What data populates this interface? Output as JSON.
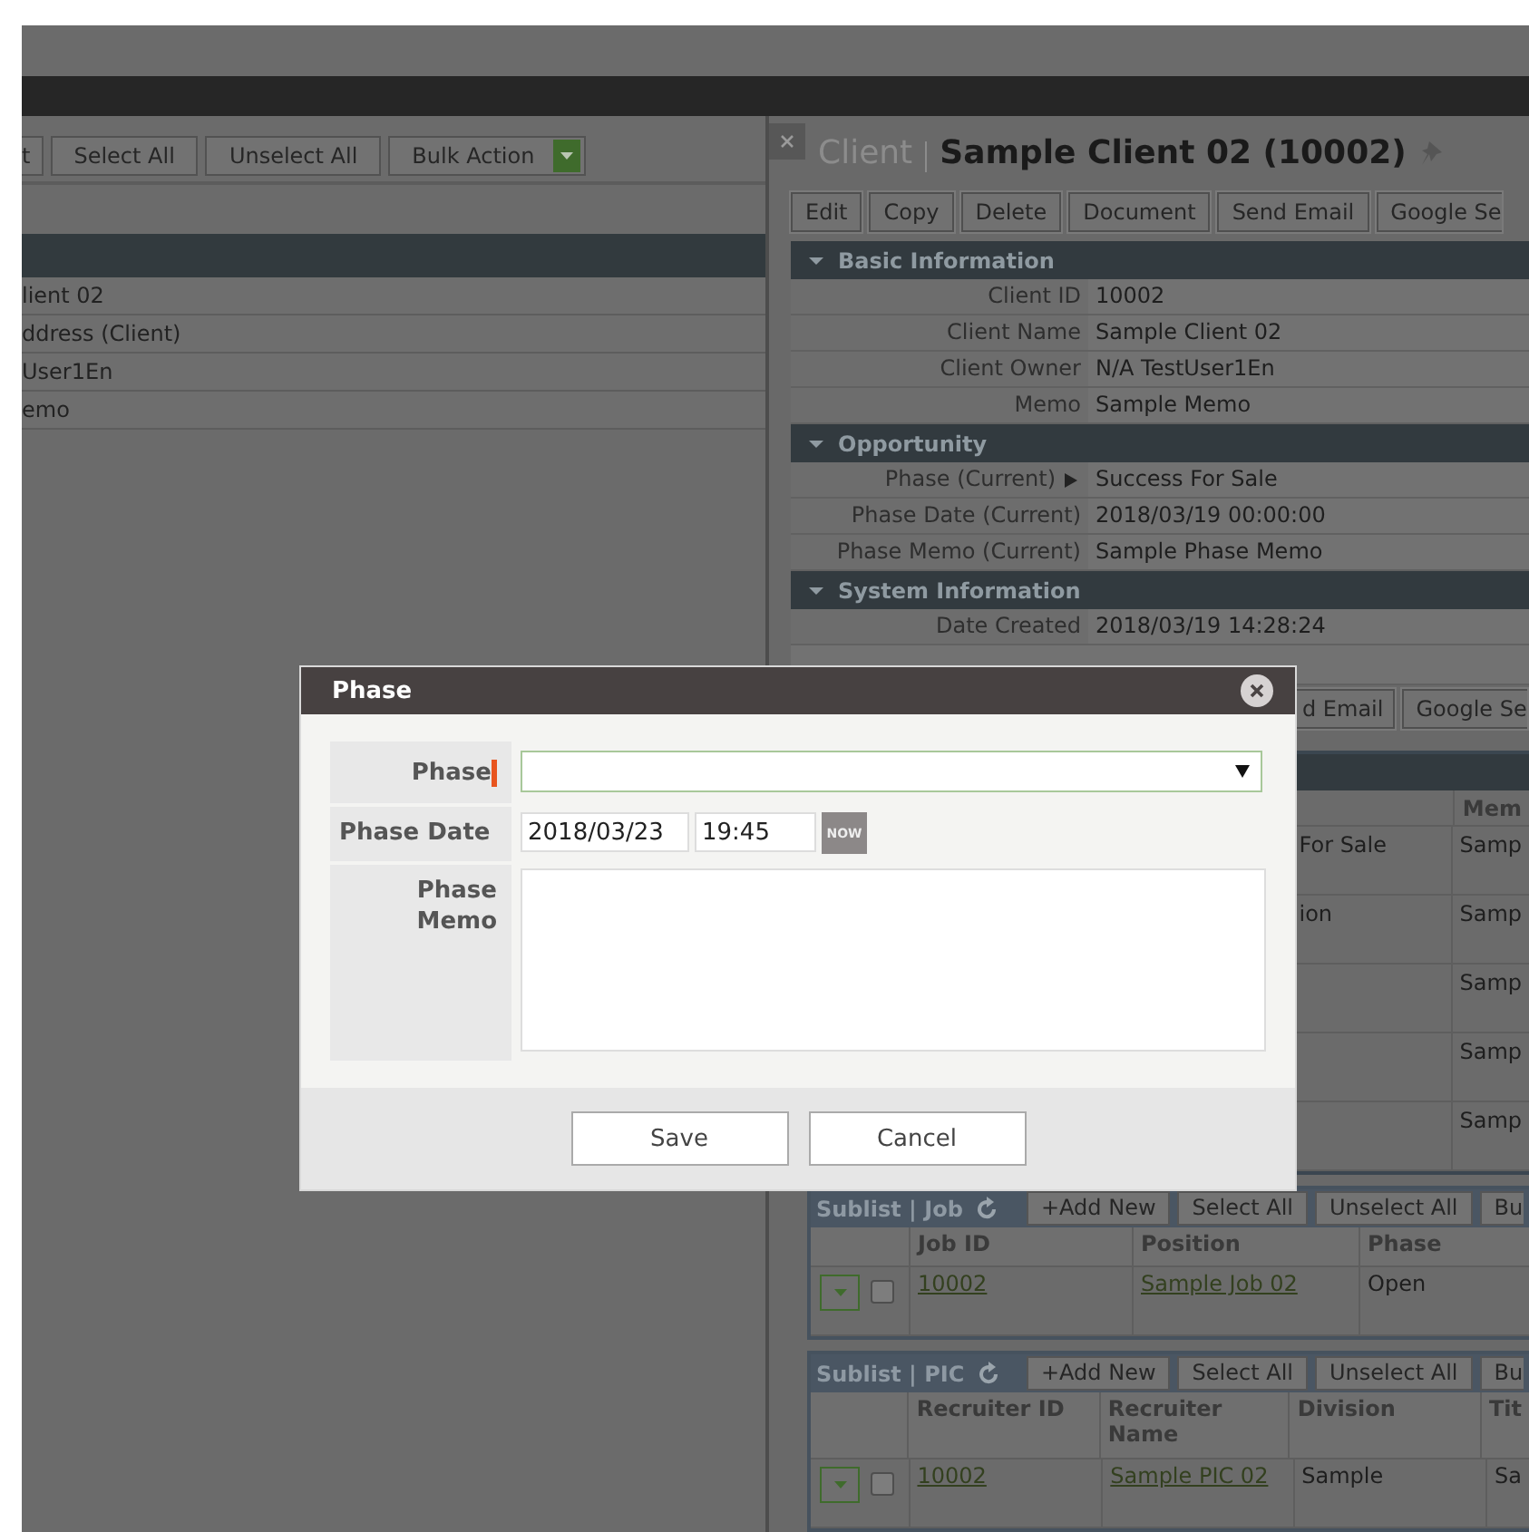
{
  "list_view": {
    "toolbar": [
      "t",
      "Select All",
      "Unselect All",
      "Bulk Action"
    ],
    "rows": [
      "lient 02",
      "ddress (Client)",
      "User1En",
      "emo"
    ]
  },
  "record": {
    "type": "Client",
    "title": "Sample Client 02 (10002)",
    "actions": [
      "Edit",
      "Copy",
      "Delete",
      "Document",
      "Send Email",
      "Google Se"
    ],
    "sections": [
      {
        "title": "Basic Information",
        "expanded": true,
        "fields": [
          {
            "kind": "plain",
            "label": "Client ID",
            "value": "10002"
          },
          {
            "kind": "plain",
            "label": "Client Name",
            "value": "Sample Client 02"
          },
          {
            "kind": "plain",
            "label": "Client Owner",
            "value": "N/A TestUser1En"
          },
          {
            "kind": "plain",
            "label": "Memo",
            "value": "Sample Memo"
          }
        ]
      },
      {
        "title": "Opportunity",
        "expanded": true,
        "fields": [
          {
            "kind": "toggle",
            "label": "Phase (Current)",
            "value": "Success For Sale"
          },
          {
            "kind": "plain",
            "label": "Phase Date (Current)",
            "value": "2018/03/19 00:00:00"
          },
          {
            "kind": "plain",
            "label": "Phase Memo (Current)",
            "value": "Sample Phase Memo"
          }
        ]
      },
      {
        "title": "System Information",
        "expanded": true,
        "fields": [
          {
            "kind": "plain",
            "label": "Date Created",
            "value": "2018/03/19 14:28:24"
          }
        ]
      }
    ],
    "actions_lower": [
      "d Email",
      "Google Se"
    ],
    "phase_history": {
      "columns": [
        "Mem"
      ],
      "rows": [
        {
          "phase": "For Sale",
          "memo": "Samp"
        },
        {
          "phase": "ion",
          "memo": "Samp"
        },
        {
          "memo": "Samp"
        },
        {
          "memo": "Samp"
        },
        {
          "memo": "Samp"
        }
      ]
    },
    "sublists": [
      {
        "title": "Sublist | Job",
        "buttons": [
          "+Add New",
          "Select All",
          "Unselect All",
          "Bu"
        ],
        "columns": [
          "Job ID",
          "Position",
          "Phase"
        ],
        "rows": [
          {
            "checked": false,
            "cells": [
              {
                "kind": "link",
                "text": "10002"
              },
              {
                "kind": "link",
                "text": "Sample Job 02"
              },
              {
                "kind": "text",
                "text": "Open"
              }
            ]
          }
        ]
      },
      {
        "title": "Sublist | PIC",
        "buttons": [
          "+Add New",
          "Select All",
          "Unselect All",
          "Bu"
        ],
        "columns": [
          "Recruiter ID",
          "Recruiter Name",
          "Division",
          "Tit"
        ],
        "rows": [
          {
            "checked": false,
            "cells": [
              {
                "kind": "link",
                "text": "10002"
              },
              {
                "kind": "link",
                "text": "Sample PIC 02"
              },
              {
                "kind": "text",
                "text": "Sample"
              },
              {
                "kind": "text",
                "text": "Sa"
              }
            ]
          }
        ]
      }
    ]
  },
  "dialog": {
    "title": "Phase",
    "fields": [
      {
        "kind": "select",
        "label": "Phase",
        "required": true
      },
      {
        "kind": "datetime",
        "label": "Phase Date",
        "required": false,
        "date": "2018/03/23",
        "time": "19:45",
        "button": "NOW"
      },
      {
        "kind": "textarea",
        "label": "Phase Memo",
        "required": false
      }
    ],
    "buttons": [
      "Save",
      "Cancel"
    ]
  }
}
